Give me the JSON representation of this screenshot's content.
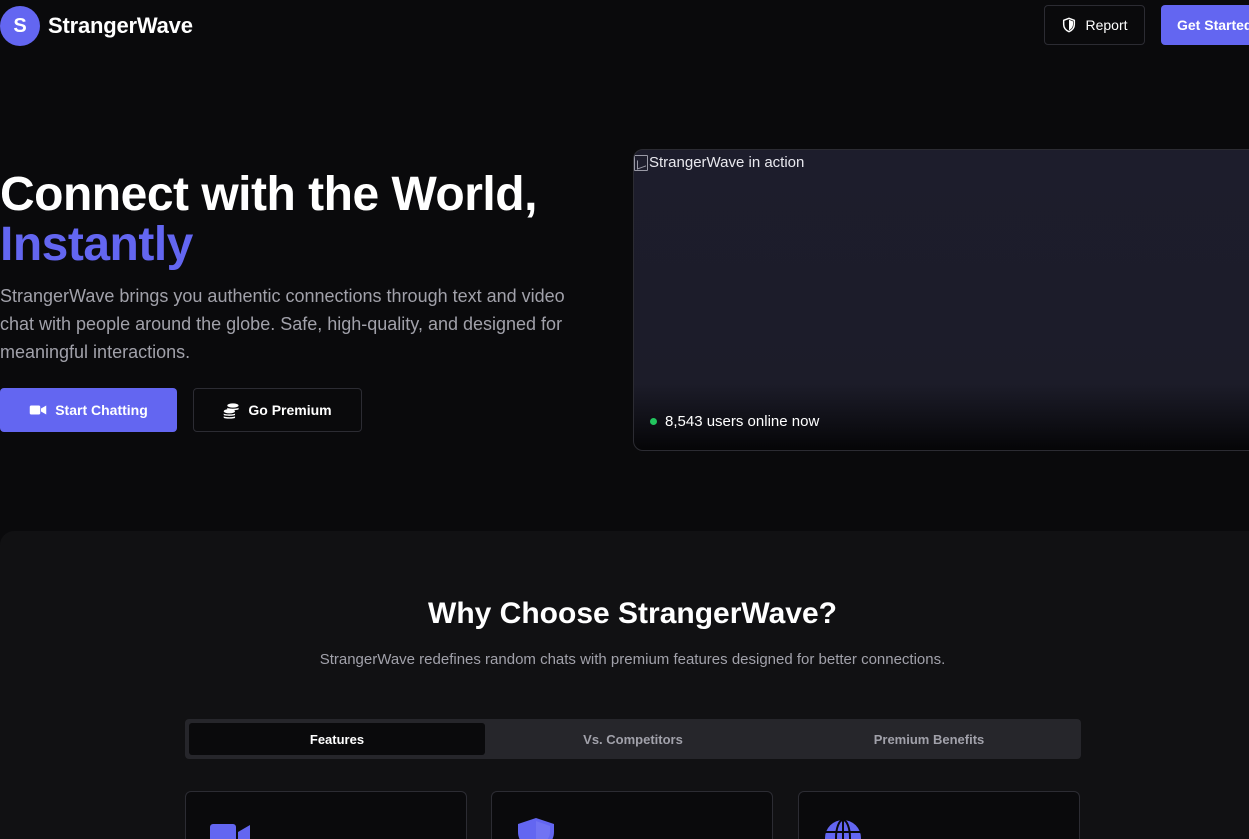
{
  "brand": {
    "logo_letter": "S",
    "name": "StrangerWave"
  },
  "header": {
    "report_label": "Report",
    "get_started_label": "Get Started"
  },
  "hero": {
    "title_line1": "Connect with the World,",
    "title_line2": "Instantly",
    "description": "StrangerWave brings you authentic connections through text and video chat with people around the globe. Safe, high-quality, and designed for meaningful interactions.",
    "start_chatting_label": "Start Chatting",
    "go_premium_label": "Go Premium",
    "image_alt": "StrangerWave in action",
    "online_text": "8,543 users online now"
  },
  "features": {
    "title": "Why Choose StrangerWave?",
    "subtitle": "StrangerWave redefines random chats with premium features designed for better connections.",
    "tabs": [
      {
        "label": "Features",
        "active": true
      },
      {
        "label": "Vs. Competitors",
        "active": false
      },
      {
        "label": "Premium Benefits",
        "active": false
      }
    ],
    "cards": [
      {
        "icon": "video-icon"
      },
      {
        "icon": "shield-icon"
      },
      {
        "icon": "globe-icon"
      }
    ]
  },
  "colors": {
    "accent": "#6366f1",
    "online": "#22c55e",
    "background": "#0a0a0c",
    "section": "#111113"
  }
}
